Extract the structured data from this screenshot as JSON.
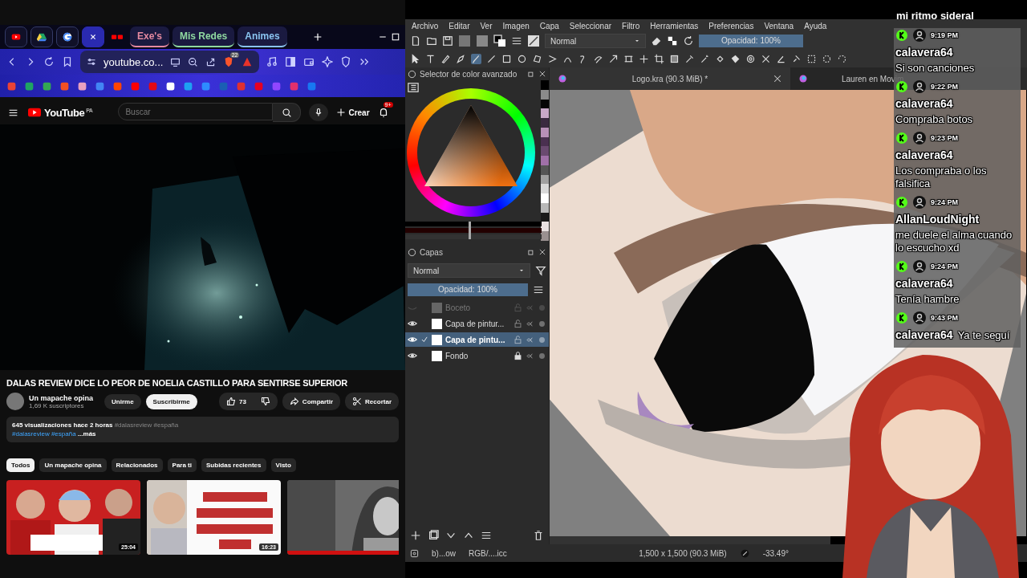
{
  "browser": {
    "tabs": [
      {
        "kind": "youtube",
        "selected": false
      },
      {
        "kind": "drive",
        "selected": false
      },
      {
        "kind": "google",
        "selected": false
      },
      {
        "kind": "close",
        "selected": true
      },
      {
        "kind": "youtube-pair",
        "selected": false
      }
    ],
    "tab_groups": [
      {
        "label": "Exe's",
        "color": "#e58aa0"
      },
      {
        "label": "Mis Redes",
        "color": "#8fd9a0"
      },
      {
        "label": "Animes",
        "color": "#8ac4f0"
      }
    ],
    "address": "youtube.co...",
    "shield_count": "22"
  },
  "youtube": {
    "logo": "YouTube",
    "region": "PA",
    "search_placeholder": "Buscar",
    "create": "Crear",
    "notifications": "9+",
    "video_title": "DALAS REVIEW DICE LO PEOR DE NOELIA CASTILLO PARA SENTIRSE SUPERIOR",
    "channel": {
      "name": "Un mapache opina",
      "subscribers": "1,69 K suscriptores"
    },
    "join": "Unirme",
    "subscribe": "Suscribirme",
    "likes": "73",
    "share": "Compartir",
    "clip": "Recortar",
    "description": {
      "stats": "645 visualizaciones  hace 2 horas",
      "tags_dim": "#dalasreview #españa",
      "tags": "#dalasreview #españa",
      "more": "...más"
    },
    "chips": [
      {
        "label": "Todos",
        "selected": true
      },
      {
        "label": "Un mapache opina",
        "selected": false
      },
      {
        "label": "Relacionados",
        "selected": false
      },
      {
        "label": "Para ti",
        "selected": false
      },
      {
        "label": "Subidas recientes",
        "selected": false
      },
      {
        "label": "Visto",
        "selected": false
      }
    ],
    "thumbnails": [
      {
        "kind": "picture",
        "duration": "25:04"
      },
      {
        "kind": "picture",
        "duration": "16:23"
      },
      {
        "kind": "picture"
      }
    ]
  },
  "krita": {
    "menu": [
      "Archivo",
      "Editar",
      "Ver",
      "Imagen",
      "Capa",
      "Seleccionar",
      "Filtro",
      "Herramientas",
      "Preferencias",
      "Ventana",
      "Ayuda"
    ],
    "blend_mode": "Normal",
    "opacity": {
      "label": "Opacidad: 100%",
      "level": 1
    },
    "color_slider": {
      "level": 0.47
    },
    "color_selector_title": "Selector de color avanzado",
    "palette": [
      {
        "color": "#000000"
      },
      {
        "color": "#8a8a8a"
      },
      {
        "color": "#050505"
      },
      {
        "color": "#c8a8c8"
      },
      {
        "color": "#3a2a40"
      },
      {
        "color": "#b890b8"
      },
      {
        "color": "#4a3050"
      },
      {
        "color": "#6a4a70"
      },
      {
        "color": "#a070a8"
      },
      {
        "color": "#555555"
      },
      {
        "color": "#a0a0a0"
      },
      {
        "color": "#d8d8d8"
      },
      {
        "color": "#ffffff"
      },
      {
        "color": "#b8b8b8"
      },
      {
        "color": "#1a1a1a"
      },
      {
        "color": "#e8e0e0"
      },
      {
        "color": "#9a9090"
      }
    ],
    "layers": {
      "title": "Capas",
      "blend_mode": "Normal",
      "opacity": {
        "label": "Opacidad:  100%",
        "level": 1
      },
      "items": [
        {
          "name": "Boceto",
          "visible": false,
          "selected": false,
          "locked": false
        },
        {
          "name": "Capa de pintur...",
          "visible": true,
          "selected": false,
          "locked": false
        },
        {
          "name": "Capa de pintu...",
          "visible": true,
          "selected": true,
          "locked": false
        },
        {
          "name": "Fondo",
          "visible": true,
          "selected": false,
          "locked": true
        }
      ]
    },
    "documents": [
      {
        "title": "Logo.kra (90.3 MiB) *",
        "selected": true
      },
      {
        "title": "Lauren en Movim",
        "selected": false
      }
    ],
    "status": [
      "b)...ow",
      "RGB/....icc",
      "1,500 x 1,500 (90.3 MiB)",
      "-33.49°"
    ]
  },
  "chat": {
    "title": "mi ritmo sideral",
    "messages": [
      {
        "time": "9:19 PM",
        "user": "calavera64",
        "text": "Si son canciones",
        "kind": "block"
      },
      {
        "time": "9:22 PM",
        "user": "calavera64",
        "text": "Compraba botos",
        "kind": "block"
      },
      {
        "time": "9:23 PM",
        "user": "calavera64",
        "text": "Los compraba o los falsifica",
        "kind": "block"
      },
      {
        "time": "9:24 PM",
        "user": "AllanLoudNight",
        "text": "me duele el alma cuando lo escucho xd",
        "kind": "block"
      },
      {
        "time": "9:24 PM",
        "user": "calavera64",
        "text": "Tenía hambre",
        "kind": "block"
      },
      {
        "time": "9:43 PM",
        "user": "calavera64",
        "text": "Ya te seguí",
        "kind": "inline"
      }
    ]
  }
}
